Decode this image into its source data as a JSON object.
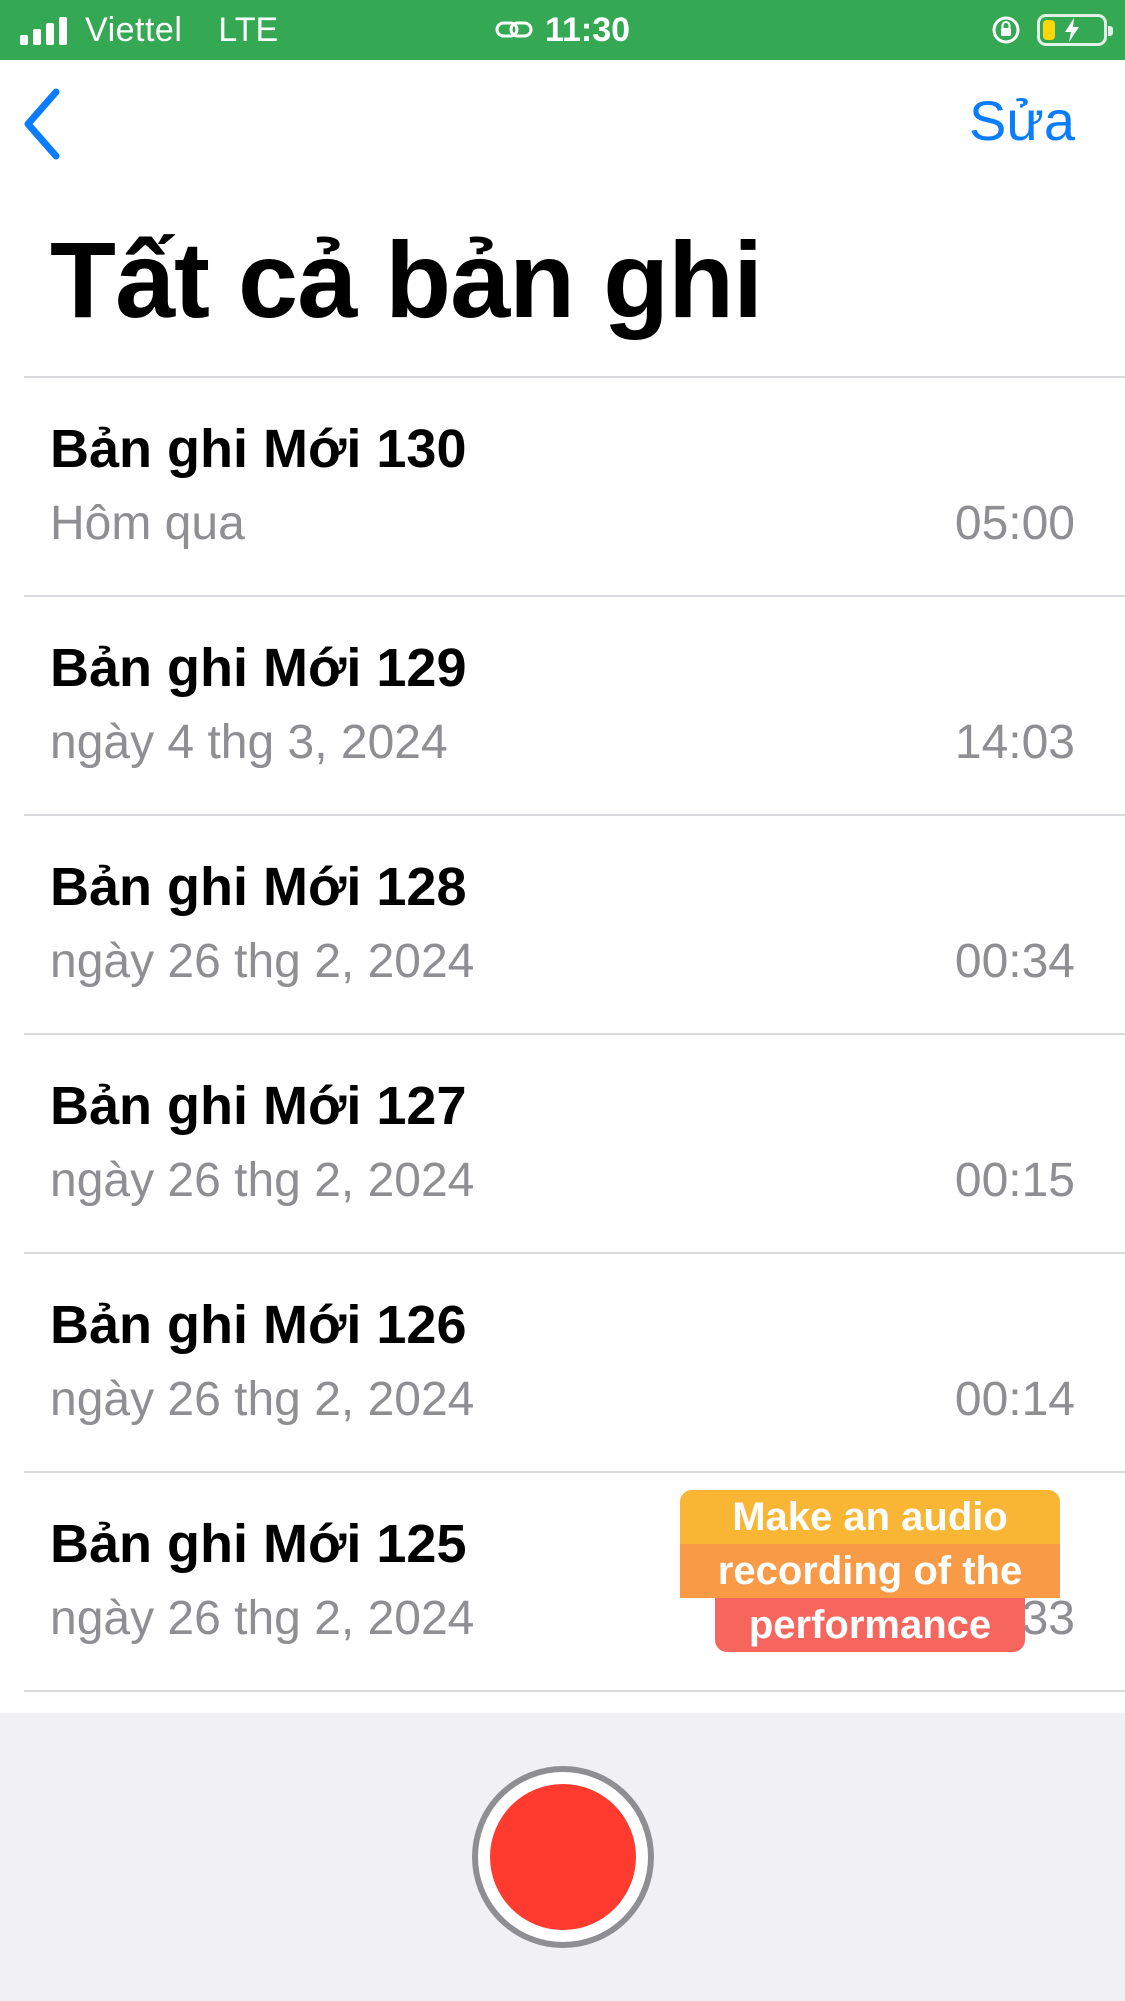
{
  "status_bar": {
    "carrier": "Viettel",
    "network": "LTE",
    "time": "11:30",
    "icons": [
      "signal-icon",
      "link-icon",
      "orientation-lock-icon",
      "battery-charging-icon"
    ],
    "battery_level": 0.2,
    "colors": {
      "background": "#34a853",
      "battery_fill": "#ffd60a"
    }
  },
  "nav": {
    "back_icon": "chevron-left-icon",
    "edit_label": "Sửa",
    "accent_color": "#0a7cff"
  },
  "page": {
    "title": "Tất cả bản ghi"
  },
  "recordings": [
    {
      "name": "Bản ghi Mới 130",
      "date": "Hôm qua",
      "duration": "05:00"
    },
    {
      "name": "Bản ghi Mới 129",
      "date": "ngày 4 thg 3, 2024",
      "duration": "14:03"
    },
    {
      "name": "Bản ghi Mới 128",
      "date": "ngày 26 thg 2, 2024",
      "duration": "00:34"
    },
    {
      "name": "Bản ghi Mới 127",
      "date": "ngày 26 thg 2, 2024",
      "duration": "00:15"
    },
    {
      "name": "Bản ghi Mới 126",
      "date": "ngày 26 thg 2, 2024",
      "duration": "00:14"
    },
    {
      "name": "Bản ghi Mới 125",
      "date": "ngày 26 thg 2, 2024",
      "duration": "…33"
    }
  ],
  "record_button": {
    "icon": "record-icon",
    "color": "#ff3b30"
  },
  "annotation": {
    "lines": [
      "Make an audio",
      "recording of the",
      "performance"
    ]
  }
}
